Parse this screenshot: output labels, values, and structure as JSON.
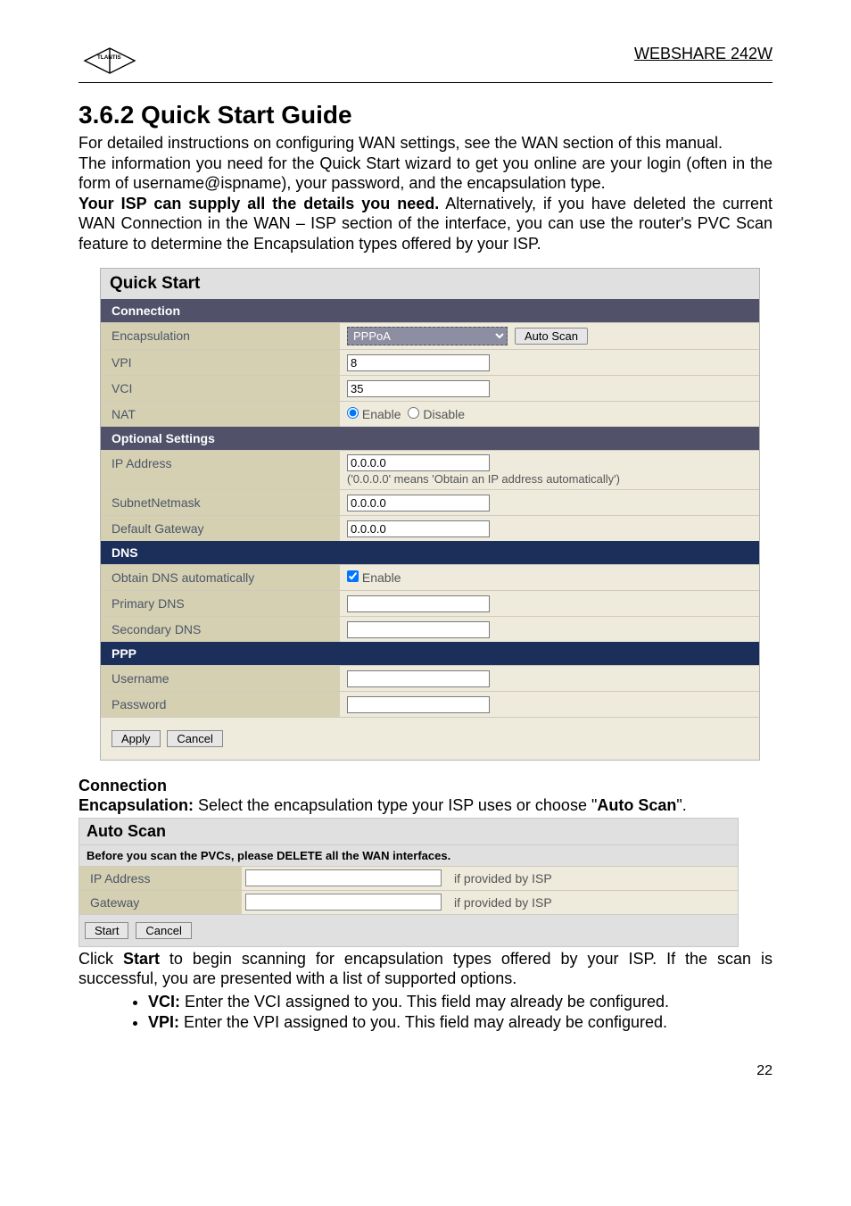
{
  "header": {
    "product": "WEBSHARE 242W"
  },
  "section": {
    "number_title": "3.6.2 Quick Start Guide",
    "intro1": "For detailed instructions on configuring WAN settings, see the WAN section of this manual.",
    "intro2": "The information you need for the Quick Start wizard to get you online are your login (often in the form of username@ispname), your password, and the encapsulation type.",
    "isp_bold": "Your ISP can supply all the details you need.",
    "isp_rest": " Alternatively, if you have deleted the current WAN Connection in the WAN – ISP section of the interface, you can use the router's PVC Scan feature to determine the Encapsulation types offered by your ISP."
  },
  "panel": {
    "title": "Quick Start",
    "groups": {
      "connection": {
        "header": "Connection",
        "encapsulation": {
          "label": "Encapsulation",
          "value": "PPPoA",
          "autoscan_btn": "Auto Scan"
        },
        "vpi": {
          "label": "VPI",
          "value": "8"
        },
        "vci": {
          "label": "VCI",
          "value": "35"
        },
        "nat": {
          "label": "NAT",
          "enable": "Enable",
          "disable": "Disable"
        }
      },
      "optional": {
        "header": "Optional Settings",
        "ip": {
          "label": "IP Address",
          "value": "0.0.0.0",
          "hint": "('0.0.0.0' means 'Obtain an IP address automatically')"
        },
        "netmask": {
          "label": "SubnetNetmask",
          "value": "0.0.0.0"
        },
        "gateway": {
          "label": "Default Gateway",
          "value": "0.0.0.0"
        }
      },
      "dns": {
        "header": "DNS",
        "auto": {
          "label": "Obtain DNS automatically",
          "enable": "Enable"
        },
        "primary": {
          "label": "Primary DNS",
          "value": ""
        },
        "secondary": {
          "label": "Secondary DNS",
          "value": ""
        }
      },
      "ppp": {
        "header": "PPP",
        "user": {
          "label": "Username",
          "value": ""
        },
        "pass": {
          "label": "Password",
          "value": ""
        }
      }
    },
    "apply": "Apply",
    "cancel": "Cancel"
  },
  "below": {
    "connection_hdr": "Connection",
    "encap_bold": "Encapsulation:",
    "encap_text": " Select the encapsulation type your ISP uses or choose \"",
    "encap_bold2": "Auto Scan",
    "encap_end": "\"."
  },
  "autoscan": {
    "title": "Auto Scan",
    "warn": "Before you scan the PVCs, please DELETE all the WAN interfaces.",
    "ip_label": "IP Address",
    "gw_label": "Gateway",
    "hint": "if provided by ISP",
    "start": "Start",
    "cancel": "Cancel"
  },
  "post": {
    "para": "Click Start to begin scanning for encapsulation types offered by your ISP. If the scan is successful, you are presented with a list of supported options.",
    "para_pre": "Click ",
    "para_bold": "Start",
    "para_post": " to begin scanning for encapsulation types offered by your ISP. If the scan is successful, you are presented with a list of supported options.",
    "vci_b": "VCI:",
    "vci_t": " Enter the VCI assigned to you. This field may already be configured.",
    "vpi_b": "VPI:",
    "vpi_t": " Enter the VPI assigned to you. This field may already be configured."
  },
  "page_number": "22"
}
